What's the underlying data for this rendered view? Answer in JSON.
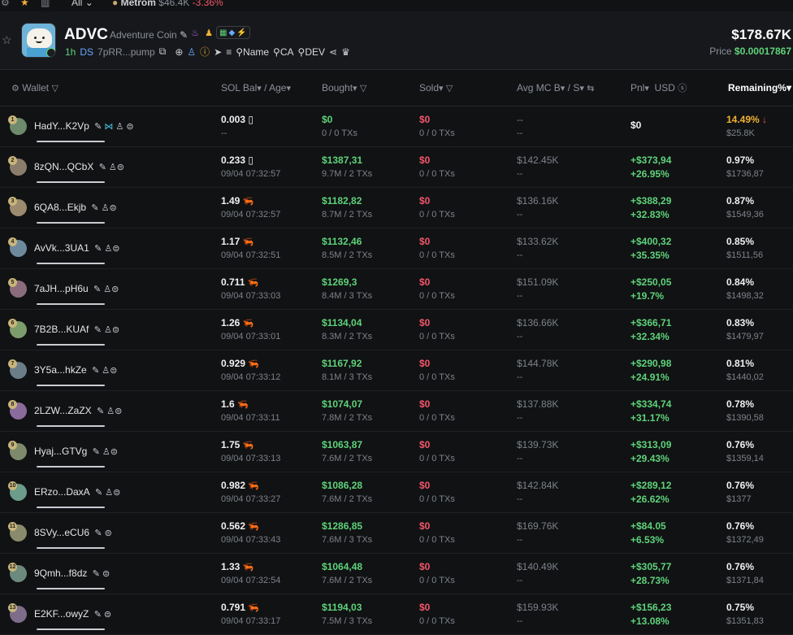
{
  "topbar": {
    "icons": [
      "gear-icon",
      "star-icon",
      "chart-icon"
    ],
    "filter_label": "All",
    "ticker_name": "Metrom",
    "ticker_value": "$46.4K",
    "ticker_change": "-3.36%"
  },
  "token": {
    "symbol": "ADVC",
    "name": "Adventure Coin",
    "age": "1h",
    "ds_label": "DS",
    "address": "7pRR...pump",
    "filters": [
      "Name",
      "CA",
      "DEV"
    ],
    "price_usd": "$178.67K",
    "price_label": "Price",
    "price_value": "$0.00017867"
  },
  "columns": {
    "wallet": "Wallet",
    "sol_bal": "SOL Bal",
    "age": "/ Age",
    "bought": "Bought",
    "sold": "Sold",
    "avg_mc": "Avg MC B",
    "avg_mc_s": "/ S",
    "pnl": "Pnl",
    "usd": "USD",
    "remaining": "Remaining%"
  },
  "colors": {
    "green": "#5ed37a",
    "red": "#f2566a",
    "orange": "#f2b233",
    "background": "#111214"
  },
  "rows": [
    {
      "wallet": "HadY...K2Vp",
      "rank": "1",
      "sol": "0.003",
      "age": "--",
      "bought": "$0",
      "bought_sub": "0 / 0 TXs",
      "sold": "$0",
      "sold_sub": "0 / 0 TXs",
      "avg_b": "--",
      "avg_s": "--",
      "pnl_usd": "$0",
      "pnl_pct": "",
      "remaining_pct": "14.49%",
      "remaining_usd": "$25.8K"
    },
    {
      "wallet": "8zQN...QCbX",
      "rank": "2",
      "sol": "0.233",
      "age": "09/04 07:32:57",
      "bought": "$1387,31",
      "bought_sub": "9.7M / 2 TXs",
      "sold": "$0",
      "sold_sub": "0 / 0 TXs",
      "avg_b": "$142.45K",
      "avg_s": "--",
      "pnl_usd": "+$373,94",
      "pnl_pct": "+26.95%",
      "remaining_pct": "0.97%",
      "remaining_usd": "$1736,87"
    },
    {
      "wallet": "6QA8...Ekjb",
      "rank": "3",
      "sol": "1.49",
      "age": "09/04 07:32:57",
      "bought": "$1182,82",
      "bought_sub": "8.7M / 2 TXs",
      "sold": "$0",
      "sold_sub": "0 / 0 TXs",
      "avg_b": "$136.16K",
      "avg_s": "--",
      "pnl_usd": "+$388,29",
      "pnl_pct": "+32.83%",
      "remaining_pct": "0.87%",
      "remaining_usd": "$1549,36"
    },
    {
      "wallet": "AvVk...3UA1",
      "rank": "4",
      "sol": "1.17",
      "age": "09/04 07:32:51",
      "bought": "$1132,46",
      "bought_sub": "8.5M / 2 TXs",
      "sold": "$0",
      "sold_sub": "0 / 0 TXs",
      "avg_b": "$133.62K",
      "avg_s": "--",
      "pnl_usd": "+$400,32",
      "pnl_pct": "+35.35%",
      "remaining_pct": "0.85%",
      "remaining_usd": "$1511,56"
    },
    {
      "wallet": "7aJH...pH6u",
      "rank": "5",
      "sol": "0.711",
      "age": "09/04 07:33:03",
      "bought": "$1269,3",
      "bought_sub": "8.4M / 3 TXs",
      "sold": "$0",
      "sold_sub": "0 / 0 TXs",
      "avg_b": "$151.09K",
      "avg_s": "--",
      "pnl_usd": "+$250,05",
      "pnl_pct": "+19.7%",
      "remaining_pct": "0.84%",
      "remaining_usd": "$1498,32"
    },
    {
      "wallet": "7B2B...KUAf",
      "rank": "6",
      "sol": "1.26",
      "age": "09/04 07:33:01",
      "bought": "$1134,04",
      "bought_sub": "8.3M / 2 TXs",
      "sold": "$0",
      "sold_sub": "0 / 0 TXs",
      "avg_b": "$136.66K",
      "avg_s": "--",
      "pnl_usd": "+$366,71",
      "pnl_pct": "+32.34%",
      "remaining_pct": "0.83%",
      "remaining_usd": "$1479,97"
    },
    {
      "wallet": "3Y5a...hkZe",
      "rank": "7",
      "sol": "0.929",
      "age": "09/04 07:33:12",
      "bought": "$1167,92",
      "bought_sub": "8.1M / 3 TXs",
      "sold": "$0",
      "sold_sub": "0 / 0 TXs",
      "avg_b": "$144.78K",
      "avg_s": "--",
      "pnl_usd": "+$290,98",
      "pnl_pct": "+24.91%",
      "remaining_pct": "0.81%",
      "remaining_usd": "$1440,02"
    },
    {
      "wallet": "2LZW...ZaZX",
      "rank": "8",
      "sol": "1.6",
      "age": "09/04 07:33:11",
      "bought": "$1074,07",
      "bought_sub": "7.8M / 2 TXs",
      "sold": "$0",
      "sold_sub": "0 / 0 TXs",
      "avg_b": "$137.88K",
      "avg_s": "--",
      "pnl_usd": "+$334,74",
      "pnl_pct": "+31.17%",
      "remaining_pct": "0.78%",
      "remaining_usd": "$1390,58"
    },
    {
      "wallet": "Hyaj...GTVg",
      "rank": "9",
      "sol": "1.75",
      "age": "09/04 07:33:13",
      "bought": "$1063,87",
      "bought_sub": "7.6M / 2 TXs",
      "sold": "$0",
      "sold_sub": "0 / 0 TXs",
      "avg_b": "$139.73K",
      "avg_s": "--",
      "pnl_usd": "+$313,09",
      "pnl_pct": "+29.43%",
      "remaining_pct": "0.76%",
      "remaining_usd": "$1359,14"
    },
    {
      "wallet": "ERzo...DaxA",
      "rank": "10",
      "sol": "0.982",
      "age": "09/04 07:33:27",
      "bought": "$1086,28",
      "bought_sub": "7.6M / 2 TXs",
      "sold": "$0",
      "sold_sub": "0 / 0 TXs",
      "avg_b": "$142.84K",
      "avg_s": "--",
      "pnl_usd": "+$289,12",
      "pnl_pct": "+26.62%",
      "remaining_pct": "0.76%",
      "remaining_usd": "$1377"
    },
    {
      "wallet": "8SVy...eCU6",
      "rank": "11",
      "sol": "0.562",
      "age": "09/04 07:33:43",
      "bought": "$1286,85",
      "bought_sub": "7.6M / 3 TXs",
      "sold": "$0",
      "sold_sub": "0 / 0 TXs",
      "avg_b": "$169.76K",
      "avg_s": "--",
      "pnl_usd": "+$84.05",
      "pnl_pct": "+6.53%",
      "remaining_pct": "0.76%",
      "remaining_usd": "$1372,49"
    },
    {
      "wallet": "9Qmh...f8dz",
      "rank": "12",
      "sol": "1.33",
      "age": "09/04 07:32:54",
      "bought": "$1064,48",
      "bought_sub": "7.6M / 2 TXs",
      "sold": "$0",
      "sold_sub": "0 / 0 TXs",
      "avg_b": "$140.49K",
      "avg_s": "--",
      "pnl_usd": "+$305,77",
      "pnl_pct": "+28.73%",
      "remaining_pct": "0.76%",
      "remaining_usd": "$1371,84"
    },
    {
      "wallet": "E2KF...owyZ",
      "rank": "13",
      "sol": "0.791",
      "age": "09/04 07:33:17",
      "bought": "$1194,03",
      "bought_sub": "7.5M / 3 TXs",
      "sold": "$0",
      "sold_sub": "0 / 0 TXs",
      "avg_b": "$159.93K",
      "avg_s": "--",
      "pnl_usd": "+$156,23",
      "pnl_pct": "+13.08%",
      "remaining_pct": "0.75%",
      "remaining_usd": "$1351,83"
    }
  ]
}
